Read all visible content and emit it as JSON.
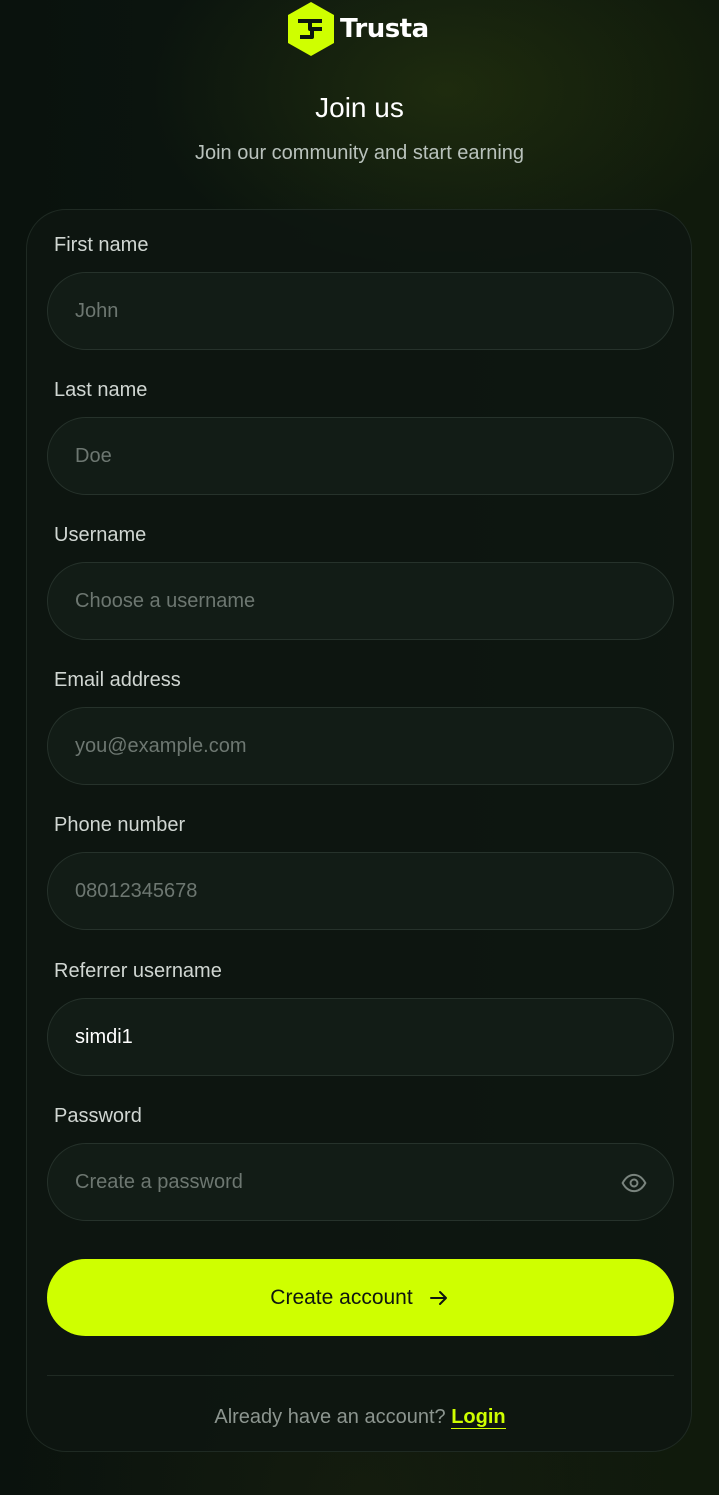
{
  "brand": {
    "name": "Trusta",
    "accent": "#cfff00",
    "logo_icon": "trusta-hexagon-logo"
  },
  "header": {
    "title": "Join us",
    "subtitle": "Join our community and start earning"
  },
  "form": {
    "first_name": {
      "label": "First name",
      "placeholder": "John",
      "value": ""
    },
    "last_name": {
      "label": "Last name",
      "placeholder": "Doe",
      "value": ""
    },
    "username": {
      "label": "Username",
      "placeholder": "Choose a username",
      "value": ""
    },
    "email": {
      "label": "Email address",
      "placeholder": "you@example.com",
      "value": ""
    },
    "phone": {
      "label": "Phone number",
      "placeholder": "08012345678",
      "value": ""
    },
    "referrer": {
      "label": "Referrer username",
      "placeholder": "",
      "value": "simdi1"
    },
    "password": {
      "label": "Password",
      "placeholder": "Create a password",
      "value": "",
      "toggle_icon": "eye-icon"
    },
    "submit_label": "Create account",
    "submit_icon": "arrow-right-icon"
  },
  "footer": {
    "prompt": "Already have an account?",
    "login_label": "Login"
  }
}
